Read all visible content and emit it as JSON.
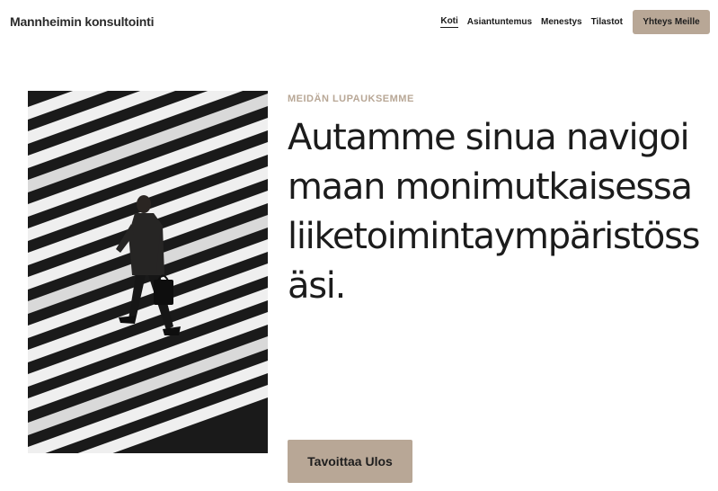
{
  "header": {
    "brand": "Mannheimin konsultointi",
    "nav": [
      {
        "label": "Koti",
        "active": true
      },
      {
        "label": "Asiantuntemus",
        "active": false
      },
      {
        "label": "Menestys",
        "active": false
      },
      {
        "label": "Tilastot",
        "active": false
      }
    ],
    "contact_button": "Yhteys Meille"
  },
  "hero": {
    "eyebrow": "MEIDÄN LUPAUKSEMME",
    "headline": "Autamme sinua navigoimaan monimutkaisessa liiketoimintaympäristössäsi.",
    "cta_label": "Tavoittaa Ulos",
    "image": "businessman-crossing-zebra-crosswalk"
  },
  "colors": {
    "accent": "#b8a796",
    "text": "#1c1c1c",
    "background": "#ffffff"
  }
}
